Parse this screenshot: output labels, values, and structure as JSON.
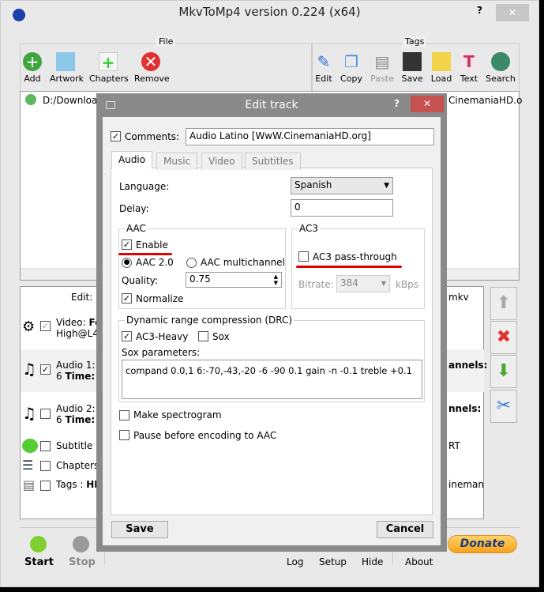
{
  "window": {
    "title": "MkvToMp4 version 0.224 (x64)",
    "help": "?",
    "close": "✕"
  },
  "file_group": {
    "label": "File",
    "buttons": [
      {
        "label": "Add",
        "icon": "add-icon"
      },
      {
        "label": "Artwork",
        "icon": "artwork-icon"
      },
      {
        "label": "Chapters",
        "icon": "chapters-icon"
      },
      {
        "label": "Remove",
        "icon": "remove-icon"
      }
    ]
  },
  "tags_group": {
    "label": "Tags",
    "buttons": [
      {
        "label": "Edit",
        "icon": "pencil-icon"
      },
      {
        "label": "Copy",
        "icon": "copy-icon"
      },
      {
        "label": "Paste",
        "icon": "paste-icon"
      },
      {
        "label": "Save",
        "icon": "floppy-icon"
      },
      {
        "label": "Load",
        "icon": "folder-icon"
      },
      {
        "label": "Text",
        "icon": "text-icon"
      },
      {
        "label": "Search",
        "icon": "globe-search-icon"
      }
    ]
  },
  "file_list": {
    "path_start": "D:/Downloa",
    "path_end": "CinemaniaHD.o"
  },
  "tracks": {
    "header_left": "Edit: ",
    "header_right": "mkv",
    "rows": [
      {
        "l1": "Video: ",
        "b1": "Fo",
        "l2": "High@L4",
        "r": "",
        "checked": true
      },
      {
        "l1": "Audio 1:",
        "l2": "6 ",
        "b2": "Time:",
        "r": "annels:",
        "checked": true
      },
      {
        "l1": "Audio 2:",
        "l2": "6 ",
        "b2": "Time:",
        "r": "nnels:",
        "checked": false
      },
      {
        "l1": "Subtitle 1",
        "r": "RT",
        "checked": false
      },
      {
        "l1": "Chapters",
        "r": "",
        "checked": false
      },
      {
        "l1": "Tags : ",
        "b1": "HI",
        "r": "ineman",
        "checked": false
      }
    ]
  },
  "bottom": {
    "start": "Start",
    "stop": "Stop",
    "log": "Log",
    "setup": "Setup",
    "hide": "Hide",
    "about": "About",
    "donate": "Donate"
  },
  "dialog": {
    "title": "Edit track",
    "help": "?",
    "close": "✕",
    "comments_label": "Comments:",
    "comments_value": "Audio Latino [WwW.CinemaniaHD.org]",
    "tabs": [
      "Audio",
      "Music",
      "Video",
      "Subtitles"
    ],
    "language_label": "Language:",
    "language_value": "Spanish",
    "delay_label": "Delay:",
    "delay_value": "0",
    "aac": {
      "label": "AAC",
      "enable": "Enable",
      "aac20": "AAC 2.0",
      "aacmulti": "AAC multichannel",
      "quality_label": "Quality:",
      "quality_value": "0.75",
      "normalize": "Normalize"
    },
    "ac3": {
      "label": "AC3",
      "passthrough": "AC3 pass-through",
      "bitrate_label": "Bitrate:",
      "bitrate_value": "384",
      "bitrate_unit": "kBps"
    },
    "drc": {
      "label": "Dynamic range compression (DRC)",
      "ac3heavy": "AC3-Heavy",
      "sox": "Sox",
      "sox_params_label": "Sox parameters:",
      "sox_params": "compand 0.0,1 6:-70,-43,-20 -6 -90 0.1 gain -n -0.1 treble +0.1"
    },
    "spectrogram": "Make spectrogram",
    "pause": "Pause before encoding to AAC",
    "save": "Save",
    "cancel": "Cancel"
  }
}
